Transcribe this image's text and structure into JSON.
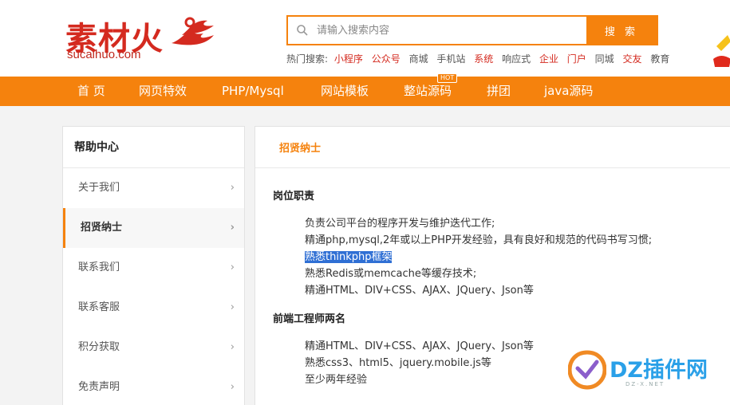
{
  "logo": {
    "name": "素材火",
    "domain": "sucaihuo.com"
  },
  "search": {
    "placeholder": "请输入搜索内容",
    "button": "搜 索"
  },
  "hot_search": {
    "label": "热门搜索:",
    "keywords": [
      {
        "text": "小程序",
        "highlight": true
      },
      {
        "text": "公众号",
        "highlight": true
      },
      {
        "text": "商城",
        "highlight": false
      },
      {
        "text": "手机站",
        "highlight": false
      },
      {
        "text": "系统",
        "highlight": true
      },
      {
        "text": "响应式",
        "highlight": false
      },
      {
        "text": "企业",
        "highlight": true
      },
      {
        "text": "门户",
        "highlight": true
      },
      {
        "text": "同城",
        "highlight": false
      },
      {
        "text": "交友",
        "highlight": true
      },
      {
        "text": "教育",
        "highlight": false
      }
    ]
  },
  "nav": {
    "items": [
      "首 页",
      "网页特效",
      "PHP/Mysql",
      "网站模板",
      "整站源码",
      "拼团",
      "java源码"
    ],
    "hot_badge": "HOT"
  },
  "sidebar": {
    "title": "帮助中心",
    "items": [
      {
        "label": "关于我们",
        "active": false
      },
      {
        "label": "招贤纳士",
        "active": true
      },
      {
        "label": "联系我们",
        "active": false
      },
      {
        "label": "联系客服",
        "active": false
      },
      {
        "label": "积分获取",
        "active": false
      },
      {
        "label": "免责声明",
        "active": false
      }
    ]
  },
  "main": {
    "heading": "招贤纳士",
    "sections": [
      {
        "title": "岗位职责",
        "lines": [
          "负责公司平台的程序开发与维护迭代工作;",
          "精通php,mysql,2年或以上PHP开发经验，具有良好和规范的代码书写习惯;",
          "熟悉thinkphp框架",
          "熟悉Redis或memcache等缓存技术;",
          "精通HTML、DIV+CSS、AJAX、JQuery、Json等"
        ]
      },
      {
        "title": "前端工程师两名",
        "lines": [
          "精通HTML、DIV+CSS、AJAX、JQuery、Json等",
          "熟悉css3、html5、jquery.mobile.js等",
          "至少两年经验"
        ]
      }
    ]
  },
  "watermark": {
    "text": "DZ插件网",
    "sub": "DZ-X.NET"
  },
  "colors": {
    "accent": "#f5820d",
    "brand_red": "#d42a1f",
    "selection": "#2f6fd4"
  }
}
